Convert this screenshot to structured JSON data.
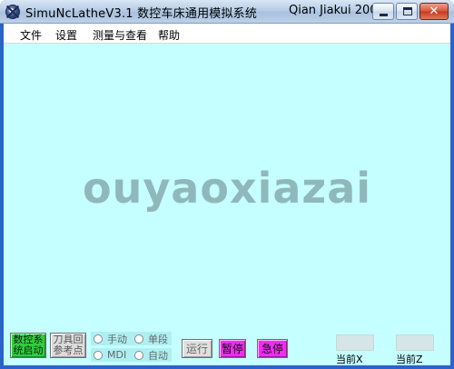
{
  "window": {
    "title": "SimuNcLatheV3.1  数控车床通用模拟系统",
    "title_right": "Qian Jiakui 200...",
    "close_glyph": "✕"
  },
  "menu": {
    "items": [
      "文件",
      "设置",
      "测量与查看",
      "帮助"
    ]
  },
  "watermark": "ouyaoxiazai",
  "controls": {
    "start_system": [
      "数控系",
      "统启动"
    ],
    "tool_home": [
      "刀具回",
      "参考点"
    ],
    "mode_manual": "手动",
    "mode_single": "单段",
    "mode_mdi": "MDI",
    "mode_auto": "自动",
    "run": "运行",
    "pause": "暂停",
    "estop": "急停",
    "current_x_label": "当前X",
    "current_z_label": "当前Z"
  },
  "colors": {
    "canvas": "#c6ffff",
    "start_button": "#2bd23b",
    "pause_button": "#f02cf0",
    "estop_button": "#f02cf0"
  }
}
